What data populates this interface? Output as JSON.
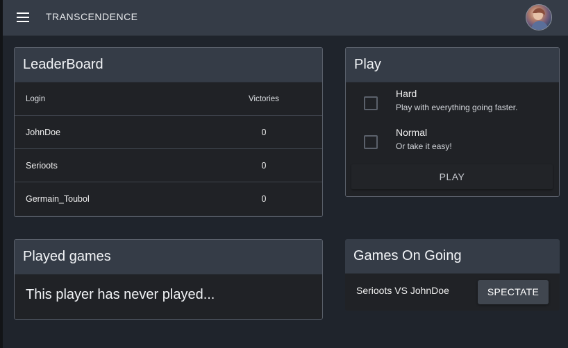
{
  "app": {
    "title": "TRANSCENDENCE",
    "menu_icon": "hamburger-menu-icon",
    "avatar": "user-avatar"
  },
  "leaderboard": {
    "title": "LeaderBoard",
    "columns": [
      "Login",
      "Victories"
    ],
    "rows": [
      {
        "login": "JohnDoe",
        "victories": "0"
      },
      {
        "login": "Serioots",
        "victories": "0"
      },
      {
        "login": "Germain_Toubol",
        "victories": "0"
      }
    ]
  },
  "play": {
    "title": "Play",
    "options": [
      {
        "label": "Hard",
        "description": "Play with everything going faster."
      },
      {
        "label": "Normal",
        "description": "Or take it easy!"
      }
    ],
    "button_label": "PLAY"
  },
  "played_games": {
    "title": "Played games",
    "empty_text": "This player has never played..."
  },
  "games_ongoing": {
    "title": "Games On Going",
    "games": [
      {
        "label": "Serioots VS JohnDoe",
        "button_label": "SPECTATE"
      }
    ]
  },
  "colors": {
    "background": "#1f242c",
    "header": "#353c47",
    "card_body": "#202226",
    "button": "#40464f"
  }
}
